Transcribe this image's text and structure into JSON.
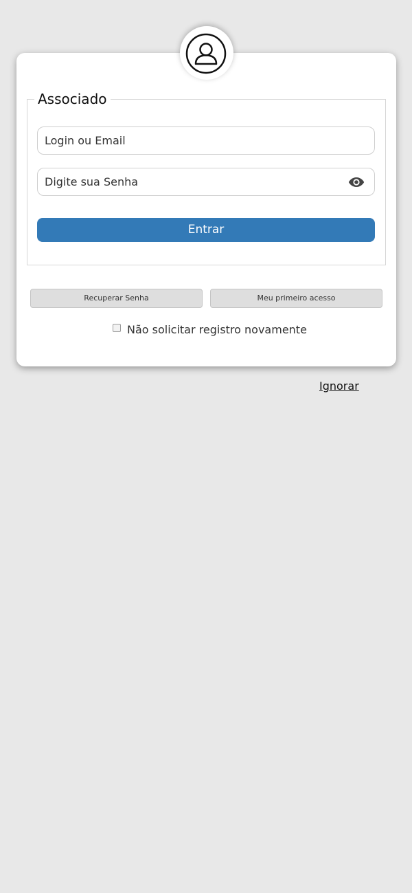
{
  "form": {
    "legend": "Associado",
    "login_placeholder": "Login ou Email",
    "password_placeholder": "Digite sua Senha",
    "submit_label": "Entrar"
  },
  "actions": {
    "recover_label": "Recuperar Senha",
    "first_access_label": "Meu primeiro acesso"
  },
  "remember": {
    "label": "Não solicitar registro novamente",
    "checked": false
  },
  "skip_label": "Ignorar",
  "icons": {
    "avatar": "user-circle-icon",
    "toggle_password": "eye-icon"
  },
  "colors": {
    "primary": "#337ab7",
    "background": "#e8e8e8"
  }
}
